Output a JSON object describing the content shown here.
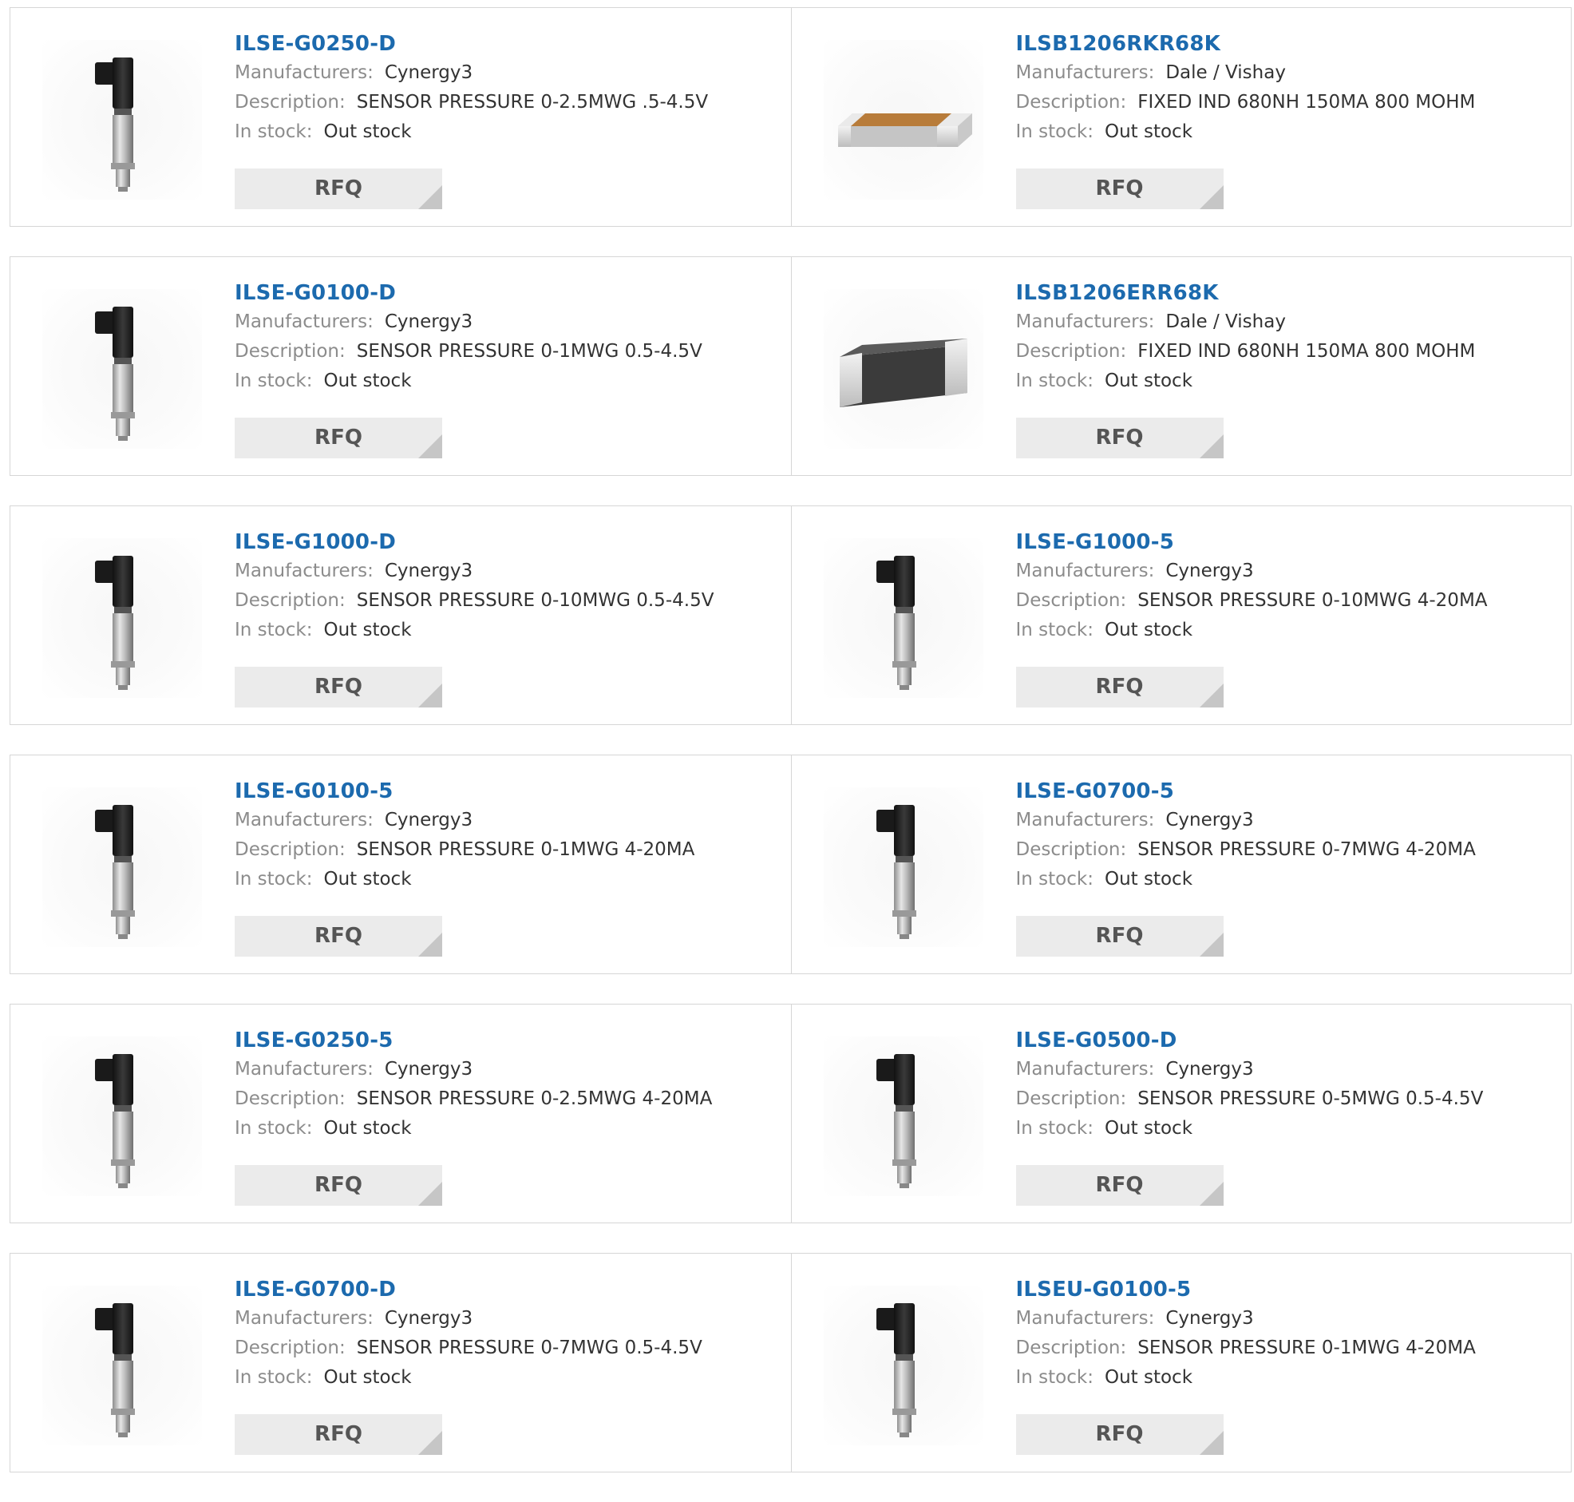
{
  "labels": {
    "manufacturers": "Manufacturers:",
    "description": "Description:",
    "in_stock": "In stock:",
    "rfq_button": "RFQ"
  },
  "products": [
    {
      "part": "ILSE-G0250-D",
      "manufacturer": "Cynergy3",
      "description": "SENSOR PRESSURE 0-2.5MWG .5-4.5V",
      "stock": "Out stock",
      "image": "pressure-sensor-image"
    },
    {
      "part": "ILSB1206RKR68K",
      "manufacturer": "Dale / Vishay",
      "description": "FIXED IND 680NH 150MA 800 MOHM",
      "stock": "Out stock",
      "image": "smd-inductor-tan-image"
    },
    {
      "part": "ILSE-G0100-D",
      "manufacturer": "Cynergy3",
      "description": "SENSOR PRESSURE 0-1MWG 0.5-4.5V",
      "stock": "Out stock",
      "image": "pressure-sensor-image"
    },
    {
      "part": "ILSB1206ERR68K",
      "manufacturer": "Dale / Vishay",
      "description": "FIXED IND 680NH 150MA 800 MOHM",
      "stock": "Out stock",
      "image": "smd-inductor-dark-image"
    },
    {
      "part": "ILSE-G1000-D",
      "manufacturer": "Cynergy3",
      "description": "SENSOR PRESSURE 0-10MWG 0.5-4.5V",
      "stock": "Out stock",
      "image": "pressure-sensor-image"
    },
    {
      "part": "ILSE-G1000-5",
      "manufacturer": "Cynergy3",
      "description": "SENSOR PRESSURE 0-10MWG 4-20MA",
      "stock": "Out stock",
      "image": "pressure-sensor-image"
    },
    {
      "part": "ILSE-G0100-5",
      "manufacturer": "Cynergy3",
      "description": "SENSOR PRESSURE 0-1MWG 4-20MA",
      "stock": "Out stock",
      "image": "pressure-sensor-image"
    },
    {
      "part": "ILSE-G0700-5",
      "manufacturer": "Cynergy3",
      "description": "SENSOR PRESSURE 0-7MWG 4-20MA",
      "stock": "Out stock",
      "image": "pressure-sensor-image"
    },
    {
      "part": "ILSE-G0250-5",
      "manufacturer": "Cynergy3",
      "description": "SENSOR PRESSURE 0-2.5MWG 4-20MA",
      "stock": "Out stock",
      "image": "pressure-sensor-image"
    },
    {
      "part": "ILSE-G0500-D",
      "manufacturer": "Cynergy3",
      "description": "SENSOR PRESSURE 0-5MWG 0.5-4.5V",
      "stock": "Out stock",
      "image": "pressure-sensor-image"
    },
    {
      "part": "ILSE-G0700-D",
      "manufacturer": "Cynergy3",
      "description": "SENSOR PRESSURE 0-7MWG 0.5-4.5V",
      "stock": "Out stock",
      "image": "pressure-sensor-image"
    },
    {
      "part": "ILSEU-G0100-5",
      "manufacturer": "Cynergy3",
      "description": "SENSOR PRESSURE 0-1MWG 4-20MA",
      "stock": "Out stock",
      "image": "pressure-sensor-image"
    }
  ],
  "colors": {
    "part_link": "#1c6aae",
    "label_gray": "#8c8c8c",
    "value_text": "#333333",
    "rfq_bg": "#ebebeb",
    "rfq_corner": "#c6c6c6",
    "border": "#d6d6d6",
    "inductor_tan": "#b87c3a",
    "inductor_dark": "#3b3b3b"
  }
}
